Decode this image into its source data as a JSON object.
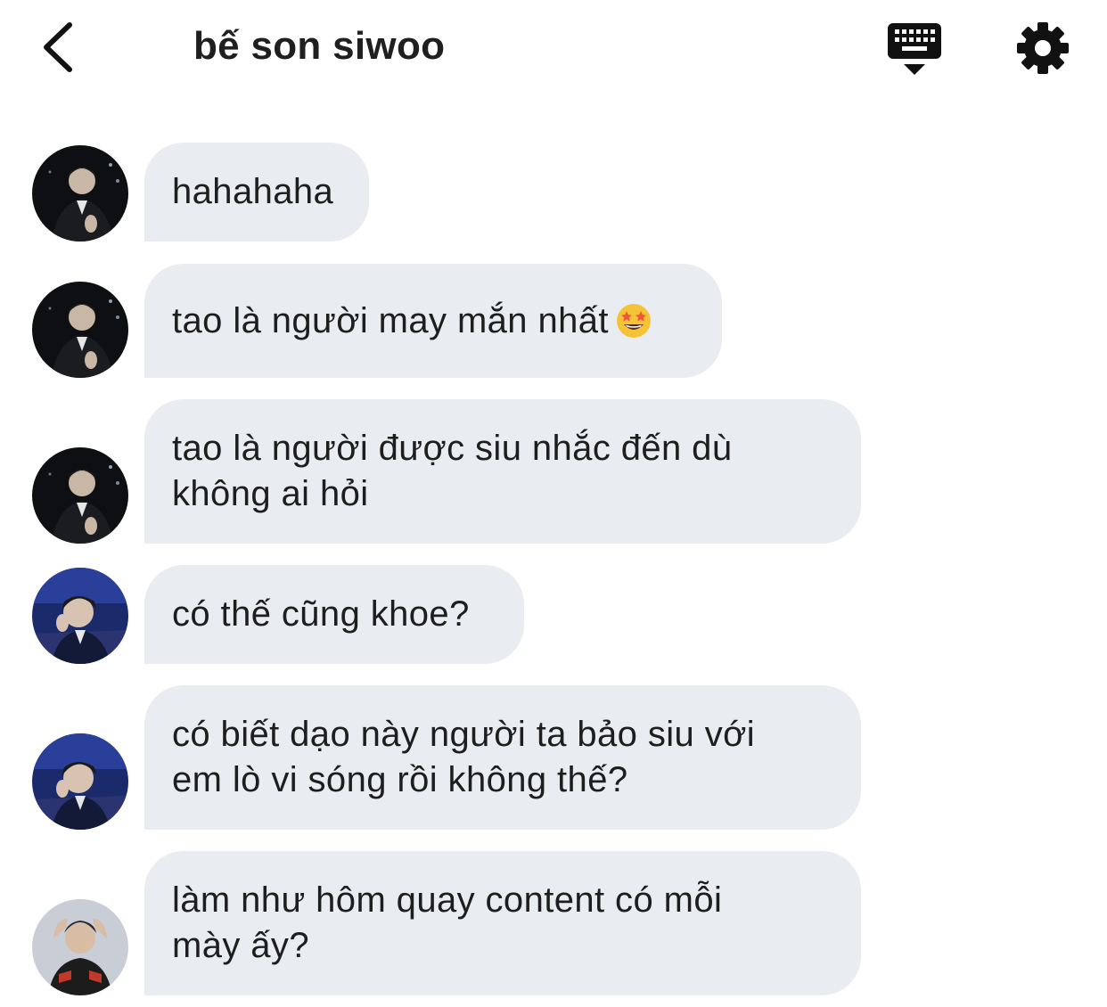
{
  "header": {
    "contact_name": "bế son siwoo",
    "back_icon": "chevron-left-icon",
    "keyboard_icon": "keyboard-hide-icon",
    "settings_icon": "gear-icon"
  },
  "colors": {
    "bubble_bg": "#e9ecf0",
    "text": "#1e1e1e",
    "icon": "#111111"
  },
  "messages": [
    {
      "text": "hahahaha",
      "avatar": "avatar-a"
    },
    {
      "text": "tao là người may mắn nhất",
      "emoji": "star-struck-emoji",
      "avatar": "avatar-a"
    },
    {
      "text": "tao là người được siu nhắc đến dù\nkhông ai hỏi",
      "avatar": "avatar-a"
    },
    {
      "text": "có thế cũng khoe?",
      "avatar": "avatar-b"
    },
    {
      "text": "có biết dạo này người ta bảo siu với\nem lò vi sóng rồi không thế?",
      "avatar": "avatar-b"
    },
    {
      "text": "làm như hôm quay content có mỗi\nmày ấy?",
      "avatar": "avatar-c"
    }
  ]
}
